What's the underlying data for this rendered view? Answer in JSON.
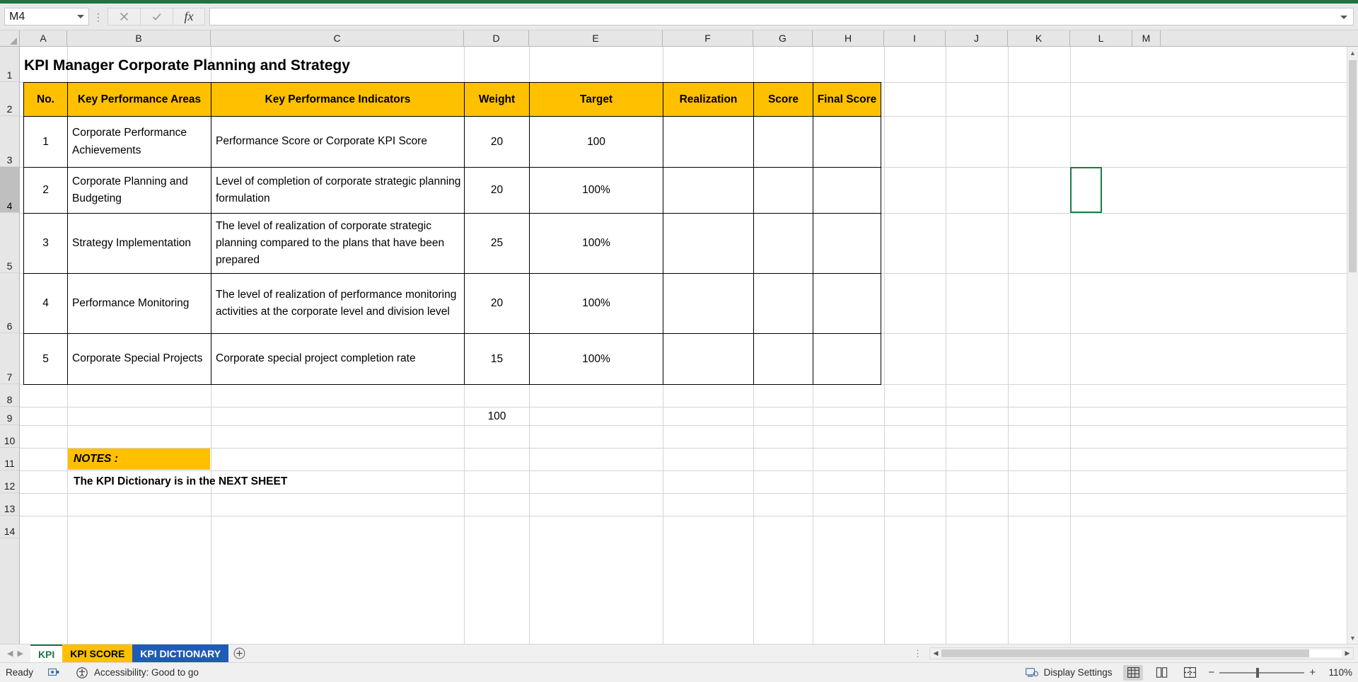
{
  "formula_bar": {
    "name_box_value": "M4",
    "formula_value": "",
    "cancel_icon": "close-icon",
    "confirm_icon": "check-icon",
    "function_icon": "fx-icon"
  },
  "columns": [
    "A",
    "B",
    "C",
    "D",
    "E",
    "F",
    "G",
    "H",
    "I",
    "J",
    "K",
    "L",
    "M"
  ],
  "rows": [
    "1",
    "2",
    "3",
    "4",
    "5",
    "6",
    "7",
    "8",
    "9",
    "10",
    "11",
    "12",
    "13",
    "14"
  ],
  "sheet": {
    "title": "KPI Manager Corporate Planning and Strategy",
    "table_headers": [
      "No.",
      "Key Performance Areas",
      "Key Performance Indicators",
      "Weight",
      "Target",
      "Realization",
      "Score",
      "Final Score"
    ],
    "table_rows": [
      {
        "no": "1",
        "area": "Corporate Performance Achievements",
        "indicator": "Performance Score or Corporate KPI Score",
        "weight": "20",
        "target": "100",
        "realization": "",
        "score": "",
        "final_score": ""
      },
      {
        "no": "2",
        "area": "Corporate Planning and Budgeting",
        "indicator": "Level of completion of corporate strategic planning formulation",
        "weight": "20",
        "target": "100%",
        "realization": "",
        "score": "",
        "final_score": ""
      },
      {
        "no": "3",
        "area": "Strategy Implementation",
        "indicator": "The level of realization of corporate strategic planning compared to the plans that have been prepared",
        "weight": "25",
        "target": "100%",
        "realization": "",
        "score": "",
        "final_score": ""
      },
      {
        "no": "4",
        "area": "Performance Monitoring",
        "indicator": "The level of realization of performance monitoring activities at the corporate level and division level",
        "weight": "20",
        "target": "100%",
        "realization": "",
        "score": "",
        "final_score": ""
      },
      {
        "no": "5",
        "area": "Corporate Special Projects",
        "indicator": "Corporate special project completion rate",
        "weight": "15",
        "target": "100%",
        "realization": "",
        "score": "",
        "final_score": ""
      }
    ],
    "weight_total": "100",
    "notes_label": "NOTES :",
    "notes_text": "The KPI Dictionary is in the NEXT SHEET",
    "header_fill_color": "#FFC000"
  },
  "sheet_tabs": [
    {
      "label": "KPI",
      "state": "active"
    },
    {
      "label": "KPI SCORE",
      "state": "orange"
    },
    {
      "label": "KPI DICTIONARY",
      "state": "blue"
    }
  ],
  "tab_controls": {
    "first_icon": "nav-first-icon",
    "prev_icon": "nav-prev-icon",
    "add_sheet_icon": "add-sheet-icon"
  },
  "status_bar": {
    "ready_text": "Ready",
    "macro_icon": "record-macro-icon",
    "accessibility_icon": "accessibility-icon",
    "accessibility_text": "Accessibility: Good to go",
    "display_settings_text": "Display Settings",
    "display_settings_icon": "display-settings-icon",
    "view_normal_icon": "normal-view-icon",
    "view_pagelayout_icon": "page-layout-view-icon",
    "view_pagebreak_icon": "page-break-view-icon",
    "zoom_out_label": "−",
    "zoom_in_label": "+",
    "zoom_level": "110%"
  }
}
